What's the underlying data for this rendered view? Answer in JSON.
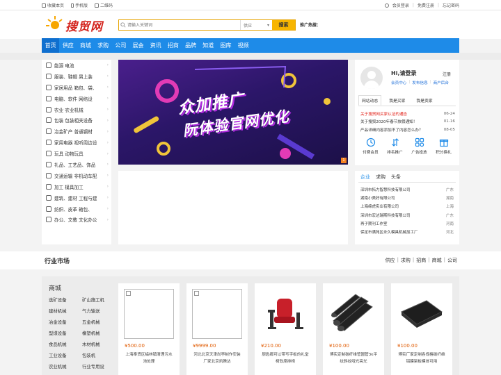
{
  "topbar": {
    "left": [
      "收藏本页",
      "手机版",
      "二维码"
    ],
    "right": [
      "会员登录",
      "免费注册",
      "忘记密码"
    ]
  },
  "header": {
    "logo_text": "搜贸网",
    "search_placeholder": "请输入关键词",
    "search_type": "供应",
    "search_button": "搜索",
    "hot_label": "推广热搜："
  },
  "nav": [
    "首页",
    "供应",
    "商城",
    "求购",
    "公司",
    "展会",
    "资讯",
    "招商",
    "品牌",
    "知道",
    "图库",
    "视频"
  ],
  "sidebar": [
    {
      "label": "能源 电池",
      "icon": "energy-icon"
    },
    {
      "label": "服装、鞋帽 男上装",
      "icon": "clothing-icon"
    },
    {
      "label": "家居用品 箱包、袋、",
      "icon": "home-icon"
    },
    {
      "label": "电脑、软件 网络设",
      "icon": "computer-icon"
    },
    {
      "label": "农业 农业机械",
      "icon": "agriculture-icon"
    },
    {
      "label": "包装 包装相关设备",
      "icon": "package-icon"
    },
    {
      "label": "冶金矿产 普通钢材",
      "icon": "metal-icon"
    },
    {
      "label": "家用电器 视听周边设",
      "icon": "appliance-icon"
    },
    {
      "label": "玩具 动物玩具",
      "icon": "toy-icon"
    },
    {
      "label": "礼品、工艺品、饰品",
      "icon": "gift-icon"
    },
    {
      "label": "交通运输 非机动车配",
      "icon": "transport-icon"
    },
    {
      "label": "加工 模具加工",
      "icon": "process-icon"
    },
    {
      "label": "建筑、建材 工程与建",
      "icon": "building-icon"
    },
    {
      "label": "纺织、皮革 箱包、",
      "icon": "textile-icon"
    },
    {
      "label": "办公、文教 文化办公",
      "icon": "office-icon"
    }
  ],
  "banner": {
    "line1": "众加推广",
    "line2": "阮体验官网优化",
    "badge": "1"
  },
  "user": {
    "greeting": "Hi,请登录",
    "register": "注册",
    "links": [
      "会员中心",
      "发布信息",
      "商户后台"
    ],
    "tabs": [
      "网站动态",
      "我是买家",
      "我是卖家"
    ],
    "news": [
      {
        "title": "关于搜贸网买家认证的通告",
        "date": "06-24"
      },
      {
        "title": "关于搜贸2020年春节放假通知！",
        "date": "01-16"
      },
      {
        "title": "产品详细内容添加不了内容怎么办？",
        "date": "08-05"
      }
    ],
    "quick": [
      {
        "label": "付费会员",
        "icon": "vip-icon"
      },
      {
        "label": "排名推广",
        "icon": "ranking-icon"
      },
      {
        "label": "广告投放",
        "icon": "ad-icon"
      },
      {
        "label": "积分换礼",
        "icon": "gift-exchange-icon"
      }
    ]
  },
  "companies": {
    "tabs": [
      "企业",
      "求购",
      "头条"
    ],
    "list": [
      {
        "name": "深圳市拓力智慧科技有限公司",
        "prov": "广东"
      },
      {
        "name": "湖南小美好有限公司",
        "prov": "湖南"
      },
      {
        "name": "上海绵虎实业有限公司",
        "prov": "上海"
      },
      {
        "name": "深圳市宏达瑞斯科技有限公司",
        "prov": "广东"
      },
      {
        "name": "再子期刊工作室",
        "prov": "河南"
      },
      {
        "name": "保定市满苑区永久模具机械加工厂",
        "prov": "河北"
      }
    ]
  },
  "market": {
    "title": "行业市场",
    "links": [
      "供应",
      "求购",
      "招商",
      "商城",
      "公司"
    ],
    "cat_title": "商城",
    "categories": [
      "选矿设备",
      "矿山施工机",
      "建材机械",
      "气力输送",
      "冶金设备",
      "五金机械",
      "型煤设备",
      "橡塑机械",
      "食品机械",
      "木材机械",
      "工业设备",
      "包装机",
      "农业机械",
      "行业专用设"
    ],
    "products": [
      {
        "price": "¥500.00",
        "name": "上海奉贤区榀林镇清理污水池处理"
      },
      {
        "price": "¥9999.00",
        "name": "河北北京天津尚亭制作安装厂家北京凯腾达"
      },
      {
        "price": "¥210.00",
        "name": "厨匙都可以带写字板的礼堂椅软席排椅"
      },
      {
        "price": "¥100.00",
        "name": "博实定制碳纤维管圆管3k平纹斜纹哑光亮光"
      },
      {
        "price": "¥100.00",
        "name": "博实厂家定制各规格碳纤维铝膜架板模体可用"
      }
    ]
  },
  "colors": {
    "nav": "#1e8be8",
    "accent": "#f7b500",
    "red": "#e2231a",
    "price": "#e05a00"
  }
}
